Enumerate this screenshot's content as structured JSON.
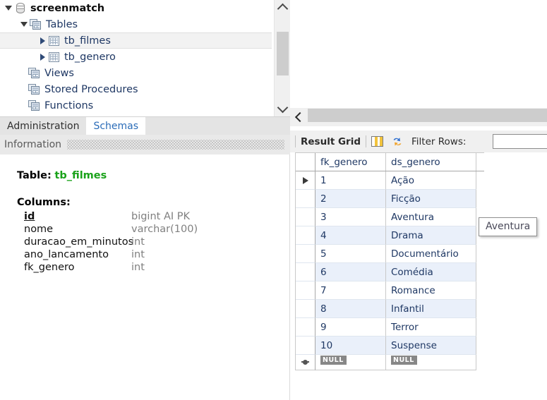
{
  "tree": {
    "items": [
      {
        "label": "screenmatch",
        "icon": "database-icon",
        "expander": "down",
        "indent": 4,
        "bold": true,
        "selected": false
      },
      {
        "label": "Tables",
        "icon": "schema-group-icon",
        "expander": "down",
        "indent": 26,
        "bold": false,
        "selected": false
      },
      {
        "label": "tb_filmes",
        "icon": "table-icon",
        "expander": "right",
        "indent": 52,
        "bold": false,
        "selected": true
      },
      {
        "label": "tb_genero",
        "icon": "table-icon",
        "expander": "right",
        "indent": 52,
        "bold": false,
        "selected": false
      },
      {
        "label": "Views",
        "icon": "schema-group-icon",
        "expander": "none",
        "indent": 40,
        "bold": false,
        "selected": false
      },
      {
        "label": "Stored Procedures",
        "icon": "schema-group-icon",
        "expander": "none",
        "indent": 40,
        "bold": false,
        "selected": false
      },
      {
        "label": "Functions",
        "icon": "schema-group-icon",
        "expander": "none",
        "indent": 40,
        "bold": false,
        "selected": false
      }
    ],
    "scrollbar": {
      "up_icon": "chevron-up-icon",
      "down_icon": "chevron-down-icon"
    }
  },
  "panel_tabs": [
    {
      "label": "Administration",
      "active": false
    },
    {
      "label": "Schemas",
      "active": true
    }
  ],
  "information": {
    "header_label": "Information",
    "table_keyword": "Table:",
    "table_name": "tb_filmes",
    "columns_heading": "Columns:",
    "columns": [
      {
        "name": "id",
        "type": "bigint AI PK",
        "primary_key": true
      },
      {
        "name": "nome",
        "type": "varchar(100)",
        "primary_key": false
      },
      {
        "name": "duracao_em_minutos",
        "type": "int",
        "primary_key": false
      },
      {
        "name": "ano_lancamento",
        "type": "int",
        "primary_key": false
      },
      {
        "name": "fk_genero",
        "type": "int",
        "primary_key": false
      }
    ]
  },
  "result_panel": {
    "collapse_icon": "chevron-left-icon",
    "toolbar": {
      "result_grid_label": "Result Grid",
      "grid_view_icon": "grid-view-icon",
      "refresh_icon": "refresh-icon",
      "filter_rows_label": "Filter Rows:",
      "filter_rows_value": "",
      "filter_rows_placeholder": ""
    },
    "grid": {
      "columns": [
        "fk_genero",
        "ds_genero"
      ],
      "rows": [
        {
          "fk_genero": "1",
          "ds_genero": "Ação",
          "marker": "current-row-arrow"
        },
        {
          "fk_genero": "2",
          "ds_genero": "Ficção",
          "marker": ""
        },
        {
          "fk_genero": "3",
          "ds_genero": "Aventura",
          "marker": ""
        },
        {
          "fk_genero": "4",
          "ds_genero": "Drama",
          "marker": ""
        },
        {
          "fk_genero": "5",
          "ds_genero": "Documentário",
          "marker": ""
        },
        {
          "fk_genero": "6",
          "ds_genero": "Comédia",
          "marker": ""
        },
        {
          "fk_genero": "7",
          "ds_genero": "Romance",
          "marker": ""
        },
        {
          "fk_genero": "8",
          "ds_genero": "Infantil",
          "marker": ""
        },
        {
          "fk_genero": "9",
          "ds_genero": "Terror",
          "marker": ""
        },
        {
          "fk_genero": "10",
          "ds_genero": "Suspense",
          "marker": ""
        }
      ],
      "new_row": {
        "fk_genero": "NULL",
        "ds_genero": "NULL",
        "marker": "new-row-star"
      }
    }
  },
  "tooltip": {
    "text": "Aventura"
  }
}
